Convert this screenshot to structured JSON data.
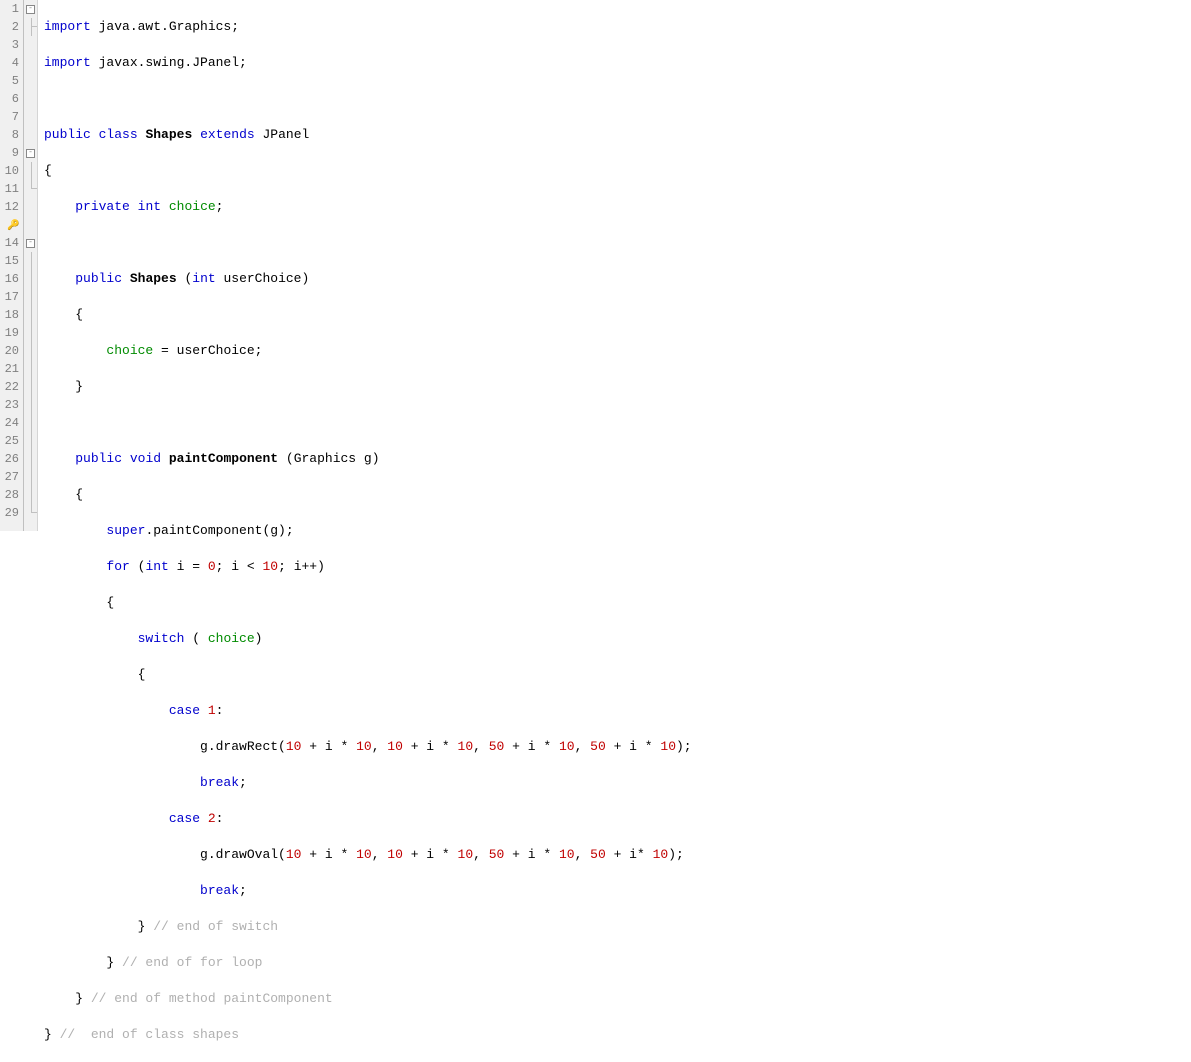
{
  "lines": {
    "count": 29
  },
  "fold": {
    "l1": "-",
    "l9": "-",
    "l14": "-"
  },
  "code": {
    "l1": {
      "kw1": "import",
      "t1": " java.awt.Graphics;"
    },
    "l2": {
      "kw1": "import",
      "t1": " javax.swing.JPanel;"
    },
    "l3": "",
    "l4": {
      "kw1": "public",
      "kw2": "class",
      "cls": "Shapes",
      "kw3": "extends",
      "t1": " JPanel"
    },
    "l5": "{",
    "l6": {
      "kw1": "private",
      "kw2": "int",
      "id1": "choice",
      "t1": ";"
    },
    "l7": "",
    "l8": {
      "kw1": "public",
      "cls": "Shapes",
      "t1": " (",
      "kw2": "int",
      "t2": " userChoice)"
    },
    "l9": "{",
    "l10": {
      "id1": "choice",
      "t1": " = userChoice;"
    },
    "l11": "}",
    "l12": "",
    "l13": {
      "kw1": "public",
      "kw2": "void",
      "m": "paintComponent",
      "t1": " (Graphics g)"
    },
    "l14": "{",
    "l15": {
      "kw1": "super",
      "t1": ".paintComponent(g);"
    },
    "l16": {
      "kw1": "for",
      "t1": " (",
      "kw2": "int",
      "t2": " i = ",
      "n1": "0",
      "t3": "; i < ",
      "n2": "10",
      "t4": "; i++)"
    },
    "l17": "{",
    "l18": {
      "kw1": "switch",
      "t1": " ( ",
      "id1": "choice",
      "t2": ")"
    },
    "l19": "{",
    "l20": {
      "kw1": "case",
      "t1": " ",
      "n1": "1",
      "t2": ":"
    },
    "l21": {
      "t1": "g.drawRect(",
      "n1": "10",
      "t2": " + i * ",
      "n2": "10",
      "t3": ", ",
      "n3": "10",
      "t4": " + i * ",
      "n4": "10",
      "t5": ", ",
      "n5": "50",
      "t6": " + i * ",
      "n6": "10",
      "t7": ", ",
      "n7": "50",
      "t8": " + i * ",
      "n8": "10",
      "t9": ");"
    },
    "l22": {
      "kw1": "break",
      "t1": ";"
    },
    "l23": {
      "kw1": "case",
      "t1": " ",
      "n1": "2",
      "t2": ":"
    },
    "l24": {
      "t1": "g.drawOval(",
      "n1": "10",
      "t2": " + i * ",
      "n2": "10",
      "t3": ", ",
      "n3": "10",
      "t4": " + i * ",
      "n4": "10",
      "t5": ", ",
      "n5": "50",
      "t6": " + i * ",
      "n6": "10",
      "t7": ", ",
      "n7": "50",
      "t8": " + i* ",
      "n8": "10",
      "t9": ");"
    },
    "l25": {
      "kw1": "break",
      "t1": ";"
    },
    "l26": {
      "t1": "} ",
      "c1": "// end of switch"
    },
    "l27": {
      "t1": "} ",
      "c1": "// end of for loop"
    },
    "l28": {
      "t1": "} ",
      "c1": "// end of method paintComponent"
    },
    "l29": {
      "t1": "} ",
      "c1": "//  end of class shapes"
    }
  }
}
